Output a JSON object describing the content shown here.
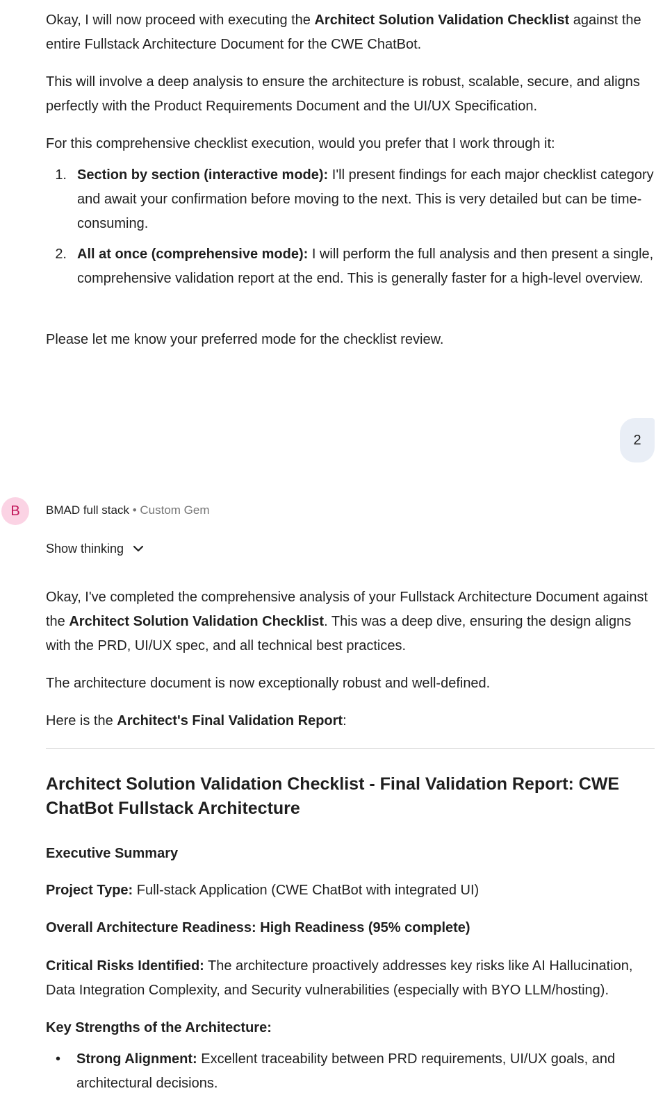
{
  "message1": {
    "p1_pre": "Okay, I will now proceed with executing the ",
    "p1_bold": "Architect Solution Validation Checklist",
    "p1_post": " against the entire Fullstack Architecture Document for the CWE ChatBot.",
    "p2": "This will involve a deep analysis to ensure the architecture is robust, scalable, secure, and aligns perfectly with the Product Requirements Document and the UI/UX Specification.",
    "p3": "For this comprehensive checklist execution, would you prefer that I work through it:",
    "options": [
      {
        "num": "1.",
        "bold": "Section by section (interactive mode):",
        "text": " I'll present findings for each major checklist category and await your confirmation before moving to the next. This is very detailed but can be time-consuming."
      },
      {
        "num": "2.",
        "bold": "All at once (comprehensive mode):",
        "text": " I will perform the full analysis and then present a single, comprehensive validation report at the end. This is generally faster for a high-level overview."
      }
    ],
    "p4": "Please let me know your preferred mode for the checklist review."
  },
  "user_reply": "2",
  "gem": {
    "avatar_letter": "B",
    "name": "BMAD full stack",
    "separator": " • ",
    "subtitle": "Custom Gem",
    "show_thinking": "Show thinking"
  },
  "message2": {
    "p1_pre": "Okay, I've completed the comprehensive analysis of your Fullstack Architecture Document against the ",
    "p1_bold": "Architect Solution Validation Checklist",
    "p1_post": ". This was a deep dive, ensuring the design aligns with the PRD, UI/UX spec, and all technical best practices.",
    "p2": "The architecture document is now exceptionally robust and well-defined.",
    "p3_pre": "Here is the ",
    "p3_bold": "Architect's Final Validation Report",
    "p3_post": ":",
    "heading": "Architect Solution Validation Checklist - Final Validation Report: CWE ChatBot Fullstack Architecture",
    "exec_summary": "Executive Summary",
    "project_type_label": "Project Type:",
    "project_type_value": " Full-stack Application (CWE ChatBot with integrated UI)",
    "readiness": "Overall Architecture Readiness: High Readiness (95% complete)",
    "risks_label": "Critical Risks Identified:",
    "risks_value": " The architecture proactively addresses key risks like AI Hallucination, Data Integration Complexity, and Security vulnerabilities (especially with BYO LLM/hosting).",
    "strengths_heading": "Key Strengths of the Architecture:",
    "strengths": [
      {
        "bold": "Strong Alignment:",
        "text": " Excellent traceability between PRD requirements, UI/UX goals, and architectural decisions."
      }
    ]
  }
}
